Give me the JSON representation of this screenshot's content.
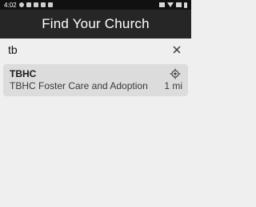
{
  "status_bar": {
    "time": "4:02"
  },
  "header": {
    "title": "Find Your Church"
  },
  "search": {
    "value": "tb"
  },
  "results": [
    {
      "name": "TBHC",
      "subtitle": "TBHC Foster Care and Adoption",
      "distance": "1 mi"
    }
  ],
  "icons": {
    "clear": "close-icon",
    "location": "location-target-icon"
  }
}
